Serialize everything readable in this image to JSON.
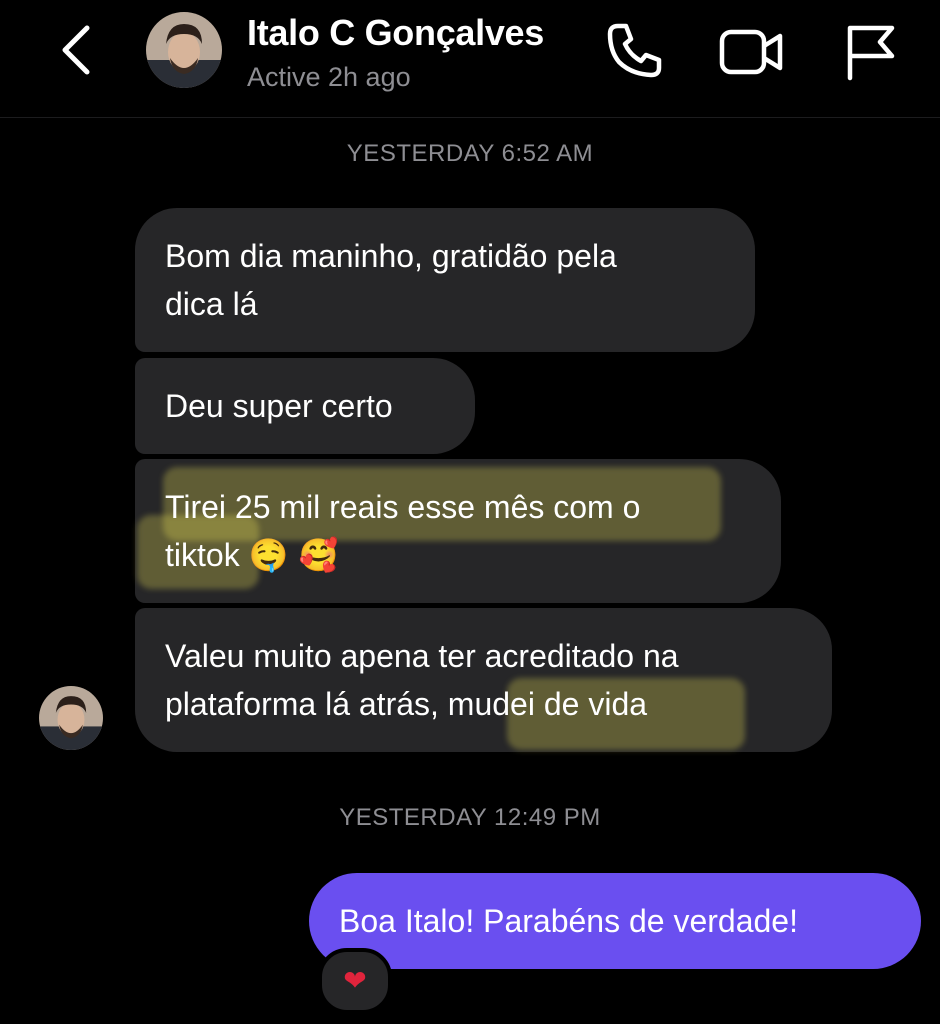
{
  "header": {
    "contact_name": "Italo C Gonçalves",
    "presence": "Active 2h ago",
    "icons": [
      "chevron-left-icon",
      "phone-icon",
      "video-camera-icon",
      "flag-icon"
    ]
  },
  "thread": {
    "timestamp_1": "YESTERDAY 6:52 AM",
    "incoming": [
      {
        "line1": "Bom dia maninho, gratidão pela",
        "line2": "dica lá"
      },
      {
        "line1": "Deu super certo"
      },
      {
        "line1": "Tirei 25 mil reais esse mês com o",
        "line2": "tiktok",
        "emoji": "🤤 🥰"
      },
      {
        "line1": "Valeu muito apena ter acreditado na",
        "line2": "plataforma lá atrás, mudei de vida"
      }
    ],
    "timestamp_2": "YESTERDAY 12:49 PM",
    "outgoing": [
      {
        "text": "Boa Italo! Parabéns de verdade!",
        "reaction": "❤"
      }
    ]
  },
  "colors": {
    "background": "#000000",
    "incoming_bubble": "#262628",
    "outgoing_bubble": "#6a4ff0",
    "secondary_text": "#8e8e93",
    "highlight": "#e8de56"
  }
}
